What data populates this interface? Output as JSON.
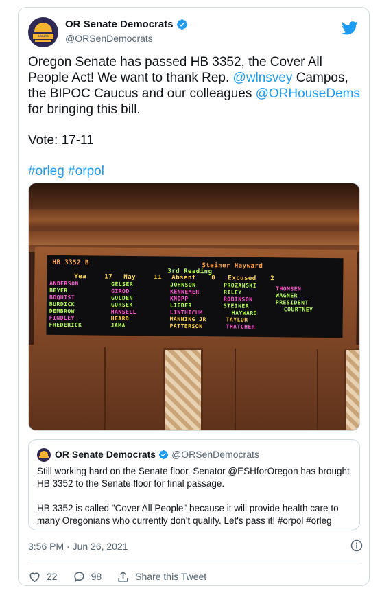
{
  "tweet": {
    "author": {
      "display_name": "OR Senate Democrats",
      "handle": "@ORSenDemocrats",
      "avatar_text": "SENATE DEMOCRATS"
    },
    "text": {
      "line1_part1": "Oregon Senate has passed HB 3352, the Cover All People Act! We want to thank Rep. ",
      "mention1": "@wlnsvey",
      "line1_part2": " Campos, the BIPOC Caucus and our colleagues ",
      "mention2": "@ORHouseDems",
      "line1_part3": " for bringing this bill.",
      "vote": "Vote: 17-11",
      "hashtag1": "#orleg",
      "hashtag2": "#orpol"
    },
    "board": {
      "bill": "HB 3352 B",
      "sponsor": "Steiner Hayward",
      "reading": "3rd Reading",
      "yea_label": "Yea",
      "yea": "17",
      "nay_label": "Nay",
      "nay": "11",
      "absent_label": "Absent",
      "absent": "0",
      "excused_label": "Excused",
      "excused": "2",
      "col1": [
        "ANDERSON",
        "BEYER",
        "BOQUIST",
        "BURDICK",
        "DEMBROW",
        "FINDLEY",
        "FREDERICK"
      ],
      "col2": [
        "GELSER",
        "GIROD",
        "GOLDEN",
        "GORSEK",
        "HANSELL",
        "HEARD",
        "JAMA"
      ],
      "col3": [
        "JOHNSON",
        "KENNEMER",
        "KNOPP",
        "LIEBER",
        "LINTHICUM",
        "MANNING JR",
        "PATTERSON"
      ],
      "col4": [
        "PROZANSKI",
        "RILEY",
        "ROBINSON",
        "STEINER",
        "HAYWARD",
        "TAYLOR",
        "THATCHER"
      ],
      "col5": [
        "THOMSEN",
        "WAGNER",
        "PRESIDENT",
        "COURTNEY"
      ]
    },
    "quoted": {
      "display_name": "OR Senate Democrats",
      "handle": "@ORSenDemocrats",
      "para1": "Still working hard on the Senate floor. Senator @ESHforOregon has brought HB 3352 to the Senate floor for final passage.",
      "para2": "HB 3352 is called \"Cover All People\" because it will provide health care to many Oregonians who currently don't qualify. Let's pass it! #orpol #orleg"
    },
    "timestamp": "3:56 PM · Jun 26, 2021",
    "likes": "22",
    "replies": "98",
    "share_label": "Share this Tweet"
  },
  "colors": {
    "link": "#1d9bf0",
    "text_primary": "#0f1419",
    "text_secondary": "#536471",
    "border": "#cfd9de",
    "brand_navy": "#2e2a55",
    "brand_gold": "#f4b330"
  }
}
